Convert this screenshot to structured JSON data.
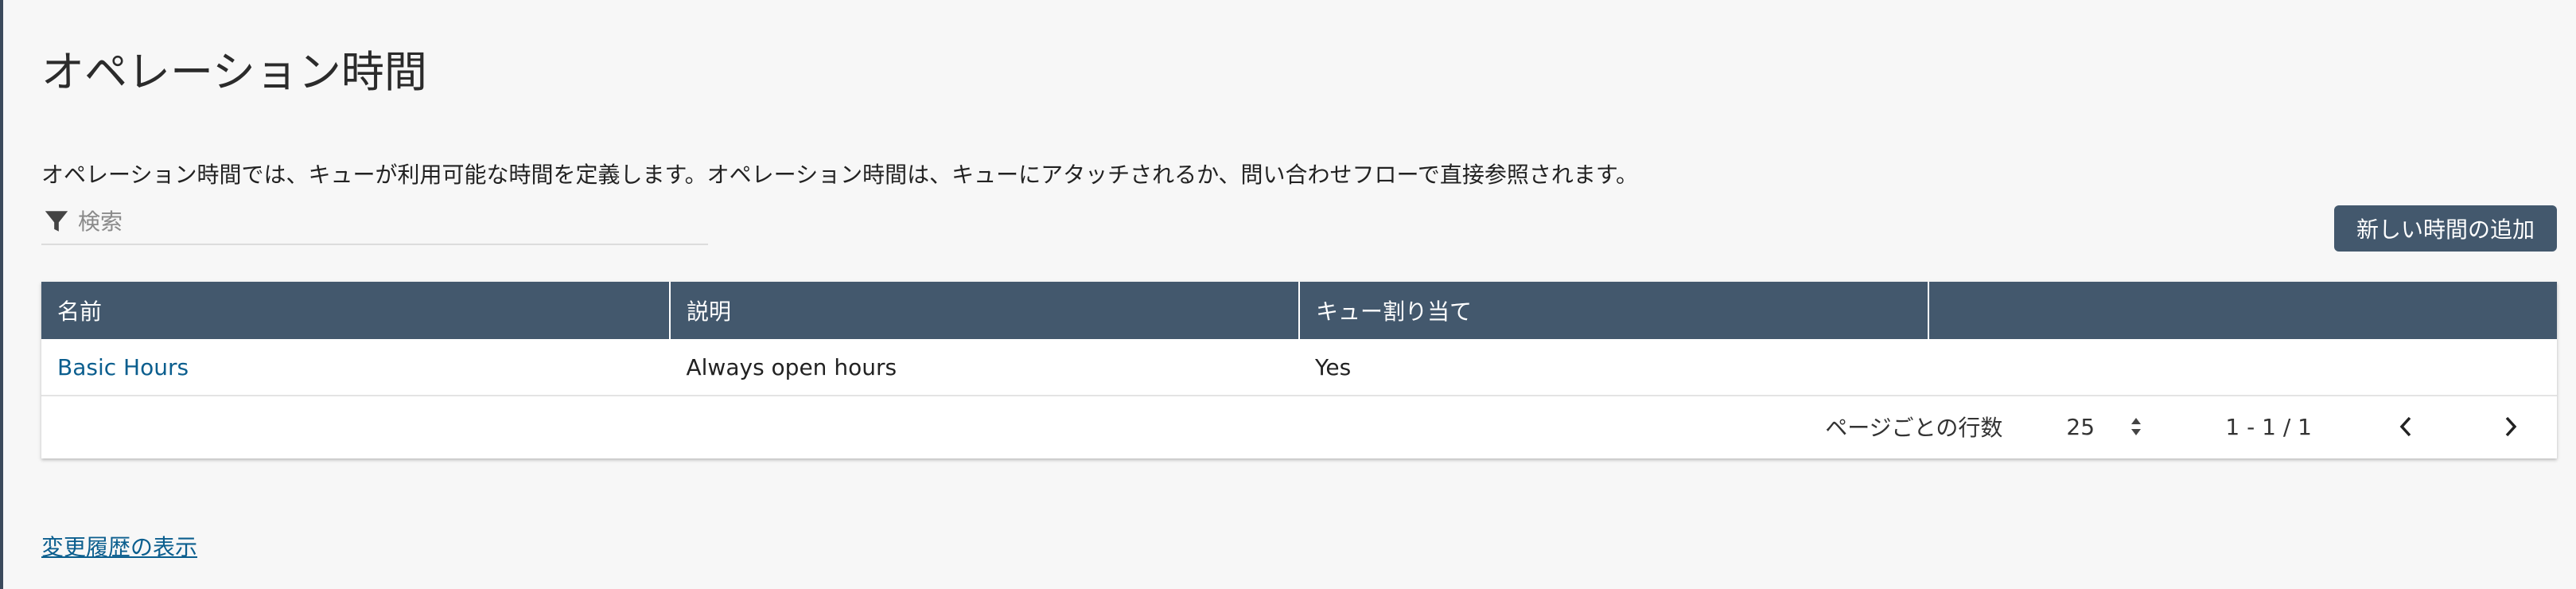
{
  "header": {
    "title": "オペレーション時間",
    "description": "オペレーション時間では、キューが利用可能な時間を定義します。オペレーション時間は、キューにアタッチされるか、問い合わせフローで直接参照されます。"
  },
  "search": {
    "placeholder": "検索",
    "value": ""
  },
  "toolbar": {
    "add_label": "新しい時間の追加"
  },
  "table": {
    "columns": [
      "名前",
      "説明",
      "キュー割り当て",
      ""
    ],
    "rows": [
      {
        "name": "Basic Hours",
        "description": "Always open hours",
        "queue_assigned": "Yes",
        "extra": ""
      }
    ]
  },
  "pagination": {
    "rows_per_page_label": "ページごとの行数",
    "rows_per_page": "25",
    "range": "1 - 1 / 1"
  },
  "footer": {
    "history_link": "変更履歴の表示"
  },
  "icons": {
    "filter": "filter-icon",
    "select": "sort-arrows-icon",
    "prev": "chevron-left-icon",
    "next": "chevron-right-icon"
  },
  "colors": {
    "header_bg": "#43586d",
    "link": "#0b5e8e",
    "page_bg": "#f7f7f7"
  }
}
